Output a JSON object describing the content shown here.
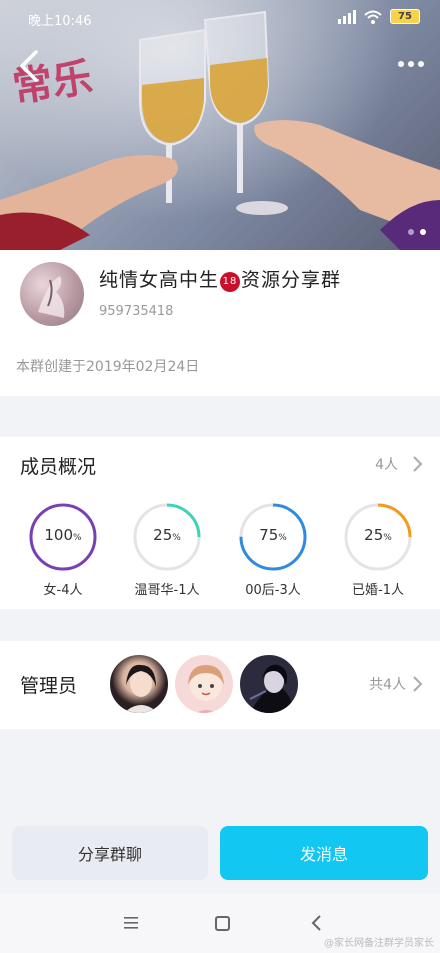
{
  "status_bar": {
    "time": "晚上10:46",
    "battery": "75"
  },
  "hero": {
    "deco_text": "常乐",
    "page_count": 2,
    "active_page": 2
  },
  "group": {
    "name_part1": "纯情女高中生",
    "badge": "18",
    "name_part2": "资源分享群",
    "id": "959735418",
    "created": "本群创建于2019年02月24日"
  },
  "members": {
    "title": "成员概况",
    "count": "4人",
    "stats": [
      {
        "value": "100",
        "unit": "%",
        "label": "女-4人",
        "color": "#7b3fb4",
        "fraction": 1.0
      },
      {
        "value": "25",
        "unit": "%",
        "label": "温哥华-1人",
        "color": "#3fd2b7",
        "fraction": 0.25
      },
      {
        "value": "75",
        "unit": "%",
        "label": "00后-3人",
        "color": "#2f8be0",
        "fraction": 0.75
      },
      {
        "value": "25",
        "unit": "%",
        "label": "已婚-1人",
        "color": "#f39a1e",
        "fraction": 0.25
      }
    ]
  },
  "admins": {
    "title": "管理员",
    "count": "共4人"
  },
  "actions": {
    "share_label": "分享群聊",
    "message_label": "发消息"
  },
  "watermark": "@家长网备注群学员家长",
  "colors": {
    "accent": "#12c8f3",
    "badge_red": "#c8102e"
  }
}
